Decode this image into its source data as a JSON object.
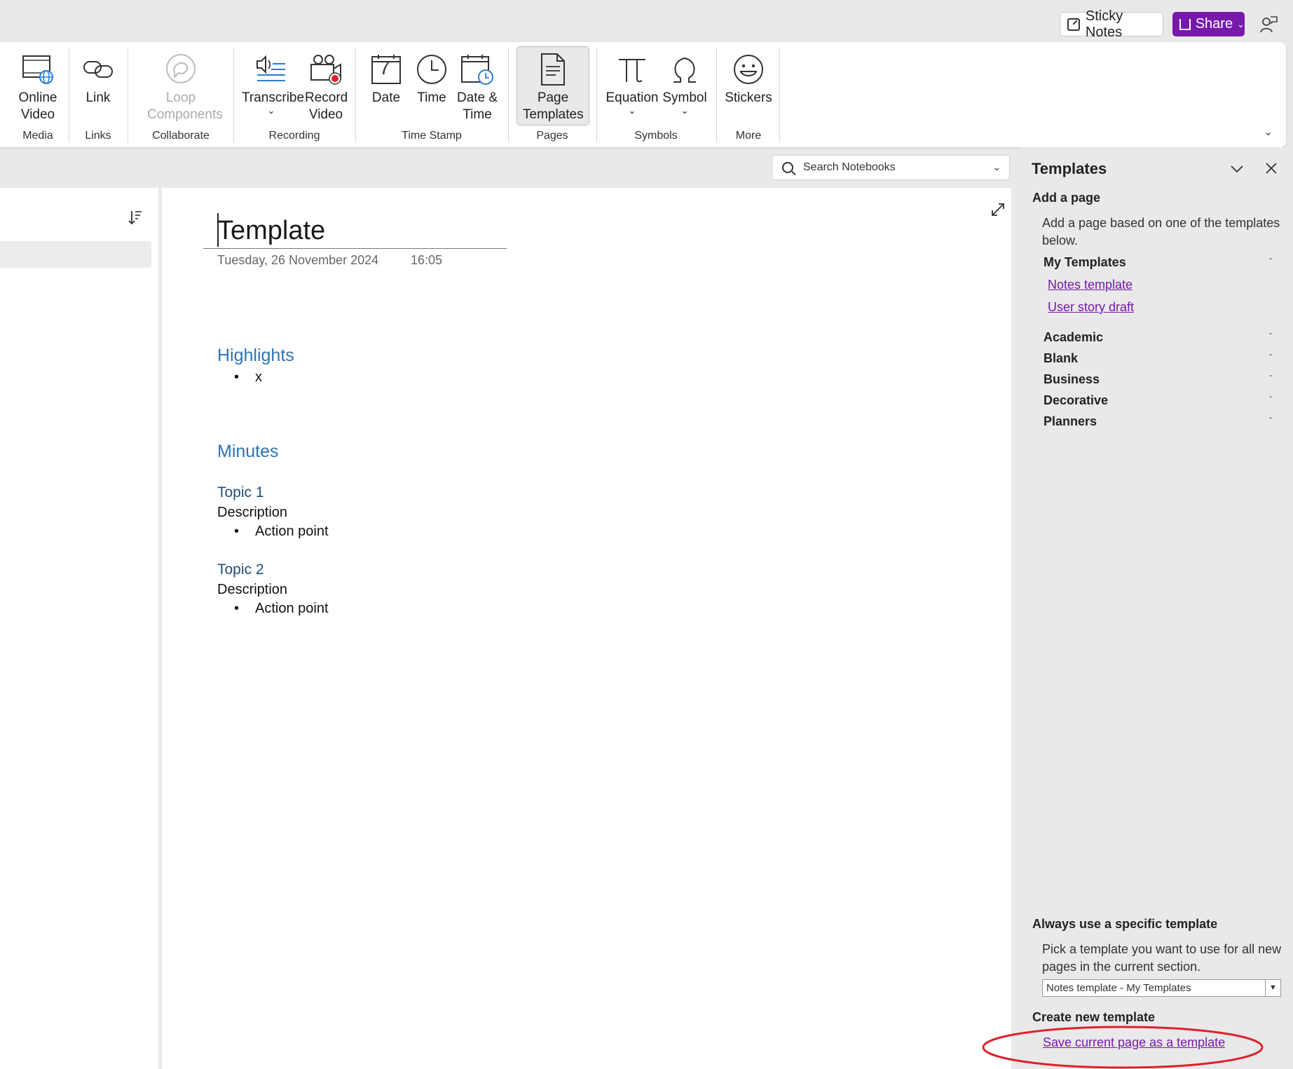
{
  "topbar": {
    "sticky_notes_label": "Sticky Notes",
    "share_label": "Share"
  },
  "ribbon": {
    "buttons": {
      "online_video": "Online Video",
      "link": "Link",
      "loop_components": "Loop Components",
      "transcribe": "Transcribe",
      "record_video": "Record Video",
      "date": "Date",
      "time": "Time",
      "date_time": "Date & Time",
      "page_templates": "Page Templates",
      "equation": "Equation",
      "symbol": "Symbol",
      "stickers": "Stickers"
    },
    "groups": {
      "media": "Media",
      "links": "Links",
      "collaborate": "Collaborate",
      "recording": "Recording",
      "time_stamp": "Time Stamp",
      "pages": "Pages",
      "symbols": "Symbols",
      "more": "More"
    },
    "date_icon_number": "7"
  },
  "search": {
    "placeholder": "Search Notebooks"
  },
  "page": {
    "title": "Template",
    "date": "Tuesday, 26 November 2024",
    "time": "16:05",
    "highlights_heading": "Highlights",
    "highlights_bullet": "x",
    "minutes_heading": "Minutes",
    "topic1": "Topic 1",
    "topic1_description": "Description",
    "topic1_action": "Action point",
    "topic2": "Topic 2",
    "topic2_description": "Description",
    "topic2_action": "Action point"
  },
  "templates_pane": {
    "title": "Templates",
    "add_page_heading": "Add a page",
    "add_page_desc": "Add a page based on one of the templates below.",
    "my_templates": "My Templates",
    "my_template_links": [
      "Notes template",
      "User story draft"
    ],
    "categories": [
      "Academic",
      "Blank",
      "Business",
      "Decorative",
      "Planners"
    ],
    "always_heading": "Always use a specific template",
    "always_desc": "Pick a template you want to use for all new pages in the current section.",
    "always_selected": "Notes template - My Templates",
    "create_heading": "Create new template",
    "save_link": "Save current page as a template"
  },
  "colors": {
    "accent_purple": "#7719aa",
    "heading_blue": "#2e75b5",
    "topic_navy": "#1f4e79",
    "annotation_red": "#e0202a"
  }
}
